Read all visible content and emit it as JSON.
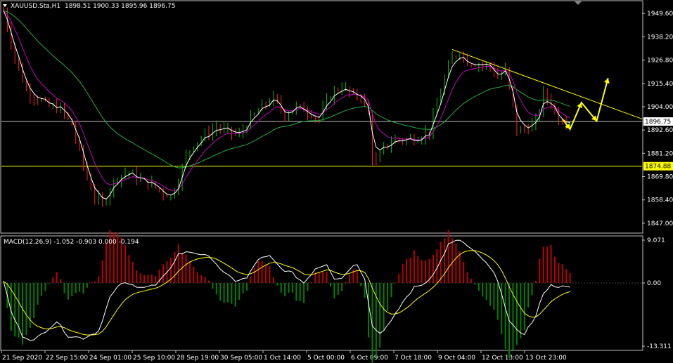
{
  "header": {
    "symbol": "XAUUSD.Sta,H1",
    "ohlc": "1898.51 1900.33 1895.96 1896.75",
    "menu_icon": "triangle-down-icon"
  },
  "macd_header": "MACD(12,26,9) -1.052 -0.903 0.000 -0.194",
  "colors": {
    "background": "#000000",
    "bull_candle": "#00c000",
    "bear_candle": "#ff2020",
    "axes": "#c0c0c0",
    "fast_ma": "#ffffff",
    "mid_ma": "#c000c0",
    "slow_ma": "#20b040",
    "trendline": "#ffff00",
    "support_line": "#ffff00",
    "bid_line": "#c0c0c0",
    "macd_line": "#ffffff",
    "signal_line": "#ffff00",
    "hist_pos": "#c00000",
    "hist_neg": "#008000"
  },
  "price_axis": {
    "ticks": [
      "1949.60",
      "1938.20",
      "1926.80",
      "1915.40",
      "1904.00",
      "1892.60",
      "1881.20",
      "1869.80",
      "1858.40",
      "1847.00"
    ],
    "current_price": "1896.75",
    "support_price": "1874.88"
  },
  "macd_axis": {
    "ticks": [
      "9.071",
      "0.00",
      "-13.311"
    ]
  },
  "time_axis": {
    "labels": [
      "21 Sep 2020",
      "22 Sep 15:00",
      "24 Sep 01:00",
      "25 Sep 10:00",
      "28 Sep 19:00",
      "30 Sep 05:00",
      "1 Oct 14:00",
      "5 Oct 00:00",
      "6 Oct 09:00",
      "7 Oct 18:00",
      "9 Oct 04:00",
      "12 Oct 13:00",
      "13 Oct 23:00"
    ]
  },
  "chart_data": {
    "type": "candlestick",
    "timeframe": "H1",
    "symbol": "XAUUSD.Sta",
    "ylim": [
      1847.0,
      1955.0
    ],
    "current_price": 1896.75,
    "support_level": 1874.88,
    "close_path": [
      [
        0,
        1951
      ],
      [
        3,
        1928
      ],
      [
        6,
        1912
      ],
      [
        9,
        1908
      ],
      [
        12,
        1904
      ],
      [
        15,
        1903
      ],
      [
        18,
        1895
      ],
      [
        20,
        1882
      ],
      [
        22,
        1869
      ],
      [
        24,
        1860
      ],
      [
        26,
        1856
      ],
      [
        28,
        1864
      ],
      [
        30,
        1870
      ],
      [
        33,
        1872
      ],
      [
        36,
        1868
      ],
      [
        39,
        1866
      ],
      [
        42,
        1862
      ],
      [
        44,
        1860
      ],
      [
        46,
        1868
      ],
      [
        48,
        1880
      ],
      [
        50,
        1886
      ],
      [
        53,
        1890
      ],
      [
        56,
        1894
      ],
      [
        59,
        1892
      ],
      [
        62,
        1890
      ],
      [
        65,
        1898
      ],
      [
        68,
        1904
      ],
      [
        71,
        1908
      ],
      [
        74,
        1900
      ],
      [
        77,
        1904
      ],
      [
        80,
        1902
      ],
      [
        83,
        1898
      ],
      [
        86,
        1910
      ],
      [
        89,
        1914
      ],
      [
        92,
        1909
      ],
      [
        94,
        1910
      ],
      [
        96,
        1900
      ],
      [
        97,
        1880
      ],
      [
        98,
        1876
      ],
      [
        100,
        1884
      ],
      [
        103,
        1888
      ],
      [
        106,
        1888
      ],
      [
        109,
        1889
      ],
      [
        112,
        1892
      ],
      [
        114,
        1905
      ],
      [
        116,
        1918
      ],
      [
        118,
        1928
      ],
      [
        120,
        1931
      ],
      [
        122,
        1926
      ],
      [
        125,
        1925
      ],
      [
        128,
        1924
      ],
      [
        130,
        1918
      ],
      [
        132,
        1922
      ],
      [
        134,
        1904
      ],
      [
        135,
        1892
      ],
      [
        137,
        1893
      ],
      [
        140,
        1896
      ],
      [
        142,
        1910
      ],
      [
        144,
        1906
      ],
      [
        146,
        1898
      ],
      [
        148,
        1897
      ],
      [
        149,
        1897
      ]
    ],
    "trendline": [
      [
        118,
        1932
      ],
      [
        165,
        1900
      ]
    ],
    "projection_arrows": [
      [
        147,
        1898
      ],
      [
        149,
        1893
      ],
      [
        152,
        1906
      ],
      [
        156,
        1897
      ],
      [
        159,
        1918
      ]
    ],
    "macd_ylim": [
      -13.311,
      9.071
    ],
    "macd_path": [
      [
        0,
        0.5
      ],
      [
        2,
        -6
      ],
      [
        5,
        -11
      ],
      [
        8,
        -12
      ],
      [
        11,
        -10
      ],
      [
        14,
        -8
      ],
      [
        17,
        -11
      ],
      [
        21,
        -11.5
      ],
      [
        25,
        -10
      ],
      [
        28,
        -3
      ],
      [
        31,
        0
      ],
      [
        34,
        -0.5
      ],
      [
        37,
        -0.8
      ],
      [
        40,
        -0.5
      ],
      [
        43,
        2
      ],
      [
        46,
        6
      ],
      [
        49,
        6.5
      ],
      [
        52,
        6
      ],
      [
        55,
        5
      ],
      [
        58,
        2
      ],
      [
        61,
        0.5
      ],
      [
        64,
        1
      ],
      [
        67,
        5
      ],
      [
        70,
        5.5
      ],
      [
        73,
        3
      ],
      [
        76,
        2
      ],
      [
        79,
        0
      ],
      [
        82,
        3
      ],
      [
        85,
        4
      ],
      [
        87,
        1
      ],
      [
        89,
        1
      ],
      [
        91,
        3
      ],
      [
        93,
        4
      ],
      [
        95,
        1
      ],
      [
        97,
        -9
      ],
      [
        99,
        -10.5
      ],
      [
        102,
        -8
      ],
      [
        105,
        -4
      ],
      [
        108,
        -1
      ],
      [
        111,
        0
      ],
      [
        114,
        3
      ],
      [
        117,
        8
      ],
      [
        120,
        9
      ],
      [
        123,
        7
      ],
      [
        126,
        5
      ],
      [
        129,
        2
      ],
      [
        131,
        -2
      ],
      [
        133,
        -8
      ],
      [
        135,
        -10
      ],
      [
        137,
        -10.5
      ],
      [
        140,
        -7
      ],
      [
        142,
        -2
      ],
      [
        144,
        -0.5
      ],
      [
        147,
        -0.8
      ],
      [
        149,
        -1.05
      ]
    ]
  }
}
